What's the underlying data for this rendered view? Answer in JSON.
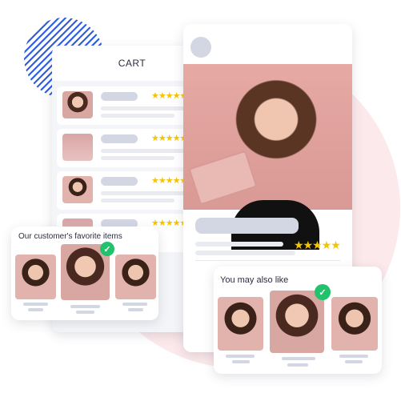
{
  "cart": {
    "title": "CART",
    "rows": [
      {
        "stars": "★★★★★"
      },
      {
        "stars": "★★★★★"
      },
      {
        "stars": "★★★★★"
      },
      {
        "stars": "★★★★★"
      }
    ]
  },
  "product": {
    "stars": "★★★★★"
  },
  "favorites": {
    "title": "Our customer's favorite items",
    "check": "✓"
  },
  "also_like": {
    "title": "You may also like",
    "check": "✓"
  },
  "colors": {
    "accent_pink": "#fbe9eb",
    "stripe_blue": "#2f5fe0",
    "star": "#f5c400",
    "check": "#22c16b",
    "placeholder": "#d3d6e3"
  }
}
